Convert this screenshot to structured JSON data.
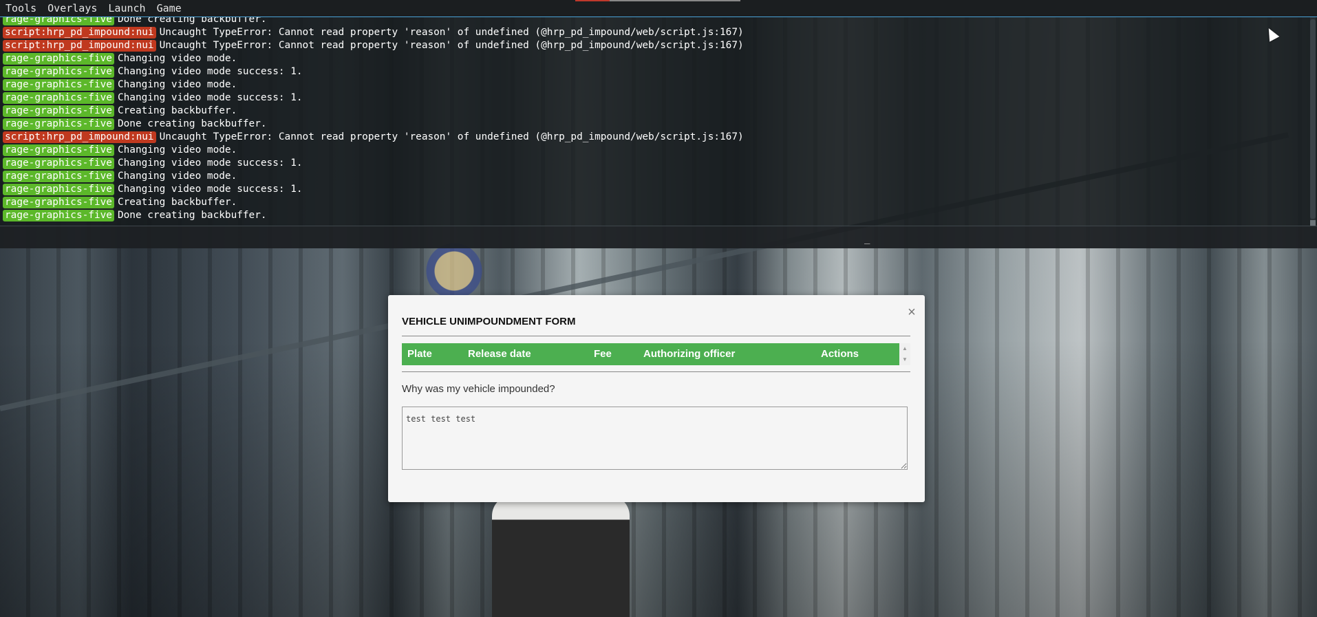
{
  "menubar": {
    "items": [
      "Tools",
      "Overlays",
      "Launch",
      "Game"
    ]
  },
  "console": {
    "lines": [
      {
        "tag": "rage-graphics-five",
        "color": "green",
        "text": "Done creating backbuffer."
      },
      {
        "tag": "script:hrp_pd_impound:nui",
        "color": "red",
        "text": "Uncaught TypeError: Cannot read property 'reason' of undefined (@hrp_pd_impound/web/script.js:167)"
      },
      {
        "tag": "script:hrp_pd_impound:nui",
        "color": "red",
        "text": "Uncaught TypeError: Cannot read property 'reason' of undefined (@hrp_pd_impound/web/script.js:167)"
      },
      {
        "tag": "rage-graphics-five",
        "color": "green",
        "text": "Changing video mode."
      },
      {
        "tag": "rage-graphics-five",
        "color": "green",
        "text": "Changing video mode success: 1."
      },
      {
        "tag": "rage-graphics-five",
        "color": "green",
        "text": "Changing video mode."
      },
      {
        "tag": "rage-graphics-five",
        "color": "green",
        "text": "Changing video mode success: 1."
      },
      {
        "tag": "rage-graphics-five",
        "color": "green",
        "text": "Creating backbuffer."
      },
      {
        "tag": "rage-graphics-five",
        "color": "green",
        "text": "Done creating backbuffer."
      },
      {
        "tag": "script:hrp_pd_impound:nui",
        "color": "red",
        "text": "Uncaught TypeError: Cannot read property 'reason' of undefined (@hrp_pd_impound/web/script.js:167)"
      },
      {
        "tag": "rage-graphics-five",
        "color": "green",
        "text": "Changing video mode."
      },
      {
        "tag": "rage-graphics-five",
        "color": "green",
        "text": "Changing video mode success: 1."
      },
      {
        "tag": "rage-graphics-five",
        "color": "green",
        "text": "Changing video mode."
      },
      {
        "tag": "rage-graphics-five",
        "color": "green",
        "text": "Changing video mode success: 1."
      },
      {
        "tag": "rage-graphics-five",
        "color": "green",
        "text": "Creating backbuffer."
      },
      {
        "tag": "rage-graphics-five",
        "color": "green",
        "text": "Done creating backbuffer."
      }
    ],
    "input_cursor": "_"
  },
  "form": {
    "title": "VEHICLE UNIMPOUNDMENT FORM",
    "close_glyph": "×",
    "columns": [
      "Plate",
      "Release date",
      "Fee",
      "Authorizing officer",
      "Actions"
    ],
    "question": "Why was my vehicle impounded?",
    "answer": "test test test"
  },
  "colors": {
    "tag_green": "#5cb82a",
    "tag_red": "#c0391f",
    "table_header": "#4caf50",
    "menu_accent": "#4aa3d8"
  },
  "icons": {
    "close": "close-icon",
    "scroll_up": "chevron-up-icon",
    "scroll_down": "chevron-down-icon",
    "cursor": "mouse-pointer-icon"
  }
}
